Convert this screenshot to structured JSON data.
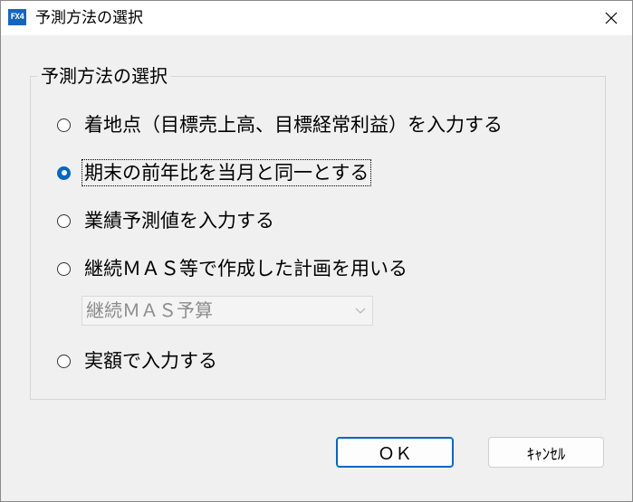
{
  "window": {
    "title": "予測方法の選択",
    "icon_text": "FX4",
    "icon_name": "fx4-app-icon",
    "accent_color": "#0067c0"
  },
  "group": {
    "legend": "予測方法の選択",
    "options": [
      {
        "label": "着地点（目標売上高、目標経常利益）を入力する",
        "checked": false
      },
      {
        "label": "期末の前年比を当月と同一とする",
        "checked": true
      },
      {
        "label": "業績予測値を入力する",
        "checked": false
      },
      {
        "label": "継続ＭＡＳ等で作成した計画を用いる",
        "checked": false
      },
      {
        "label": "実額で入力する",
        "checked": false
      }
    ],
    "plan_dropdown": {
      "selected": "継続ＭＡＳ予算",
      "enabled": false
    }
  },
  "buttons": {
    "ok_label": "ＯＫ",
    "cancel_label": "ｷｬﾝｾﾙ"
  }
}
